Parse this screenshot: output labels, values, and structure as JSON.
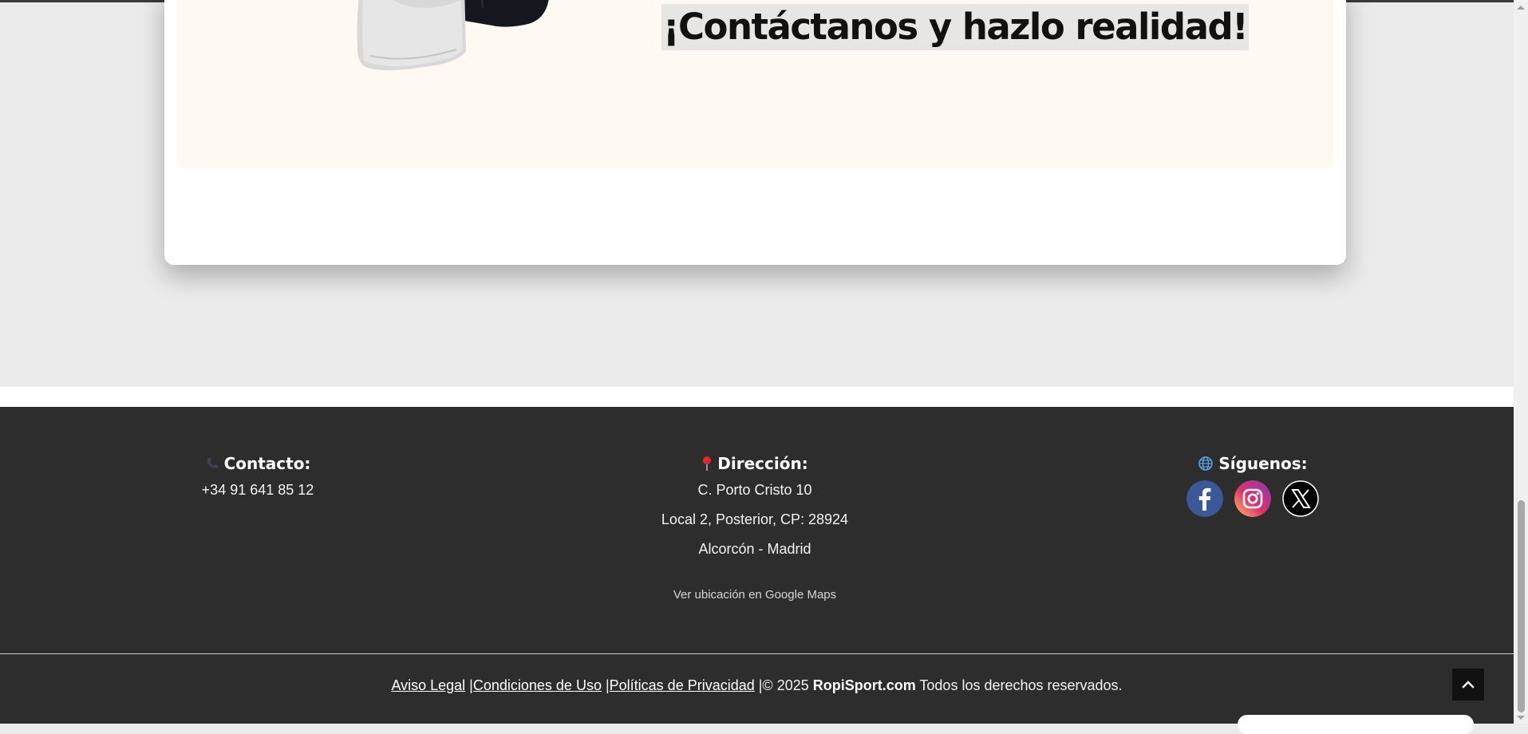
{
  "promo": {
    "cta_text": "¡Contáctanos y hazlo realidad!"
  },
  "footer": {
    "contact": {
      "icon": "phone-icon",
      "title": "Contacto:",
      "phone": "+34 91 641 85 12"
    },
    "address": {
      "icon": "map-pin-icon",
      "title": "Dirección:",
      "line1": "C. Porto Cristo 10",
      "line2": "Local 2, Posterior, CP: 28924",
      "line3": "Alcorcón - Madrid",
      "maps_link": "Ver ubicación en Google Maps"
    },
    "social": {
      "icon": "globe-icon",
      "title": "Síguenos:",
      "networks": [
        {
          "name": "facebook-icon",
          "color": "#3b5998"
        },
        {
          "name": "instagram-icon",
          "color": "#e1306c"
        },
        {
          "name": "x-icon",
          "color": "#000000"
        }
      ]
    },
    "legal": {
      "aviso_legal": "Aviso Legal",
      "sep1": " |",
      "condiciones": "Condiciones de Uso",
      "sep2": " |",
      "privacidad": "Políticas de Privacidad",
      "copyright_prefix": " |© 2025 ",
      "brand": "RopiSport.com",
      "rights": " Todos los derechos reservados."
    }
  },
  "colors": {
    "footer_bg": "#2d2d2d",
    "page_bg": "#ebebeb",
    "promo_bg": "#fff8f3"
  }
}
